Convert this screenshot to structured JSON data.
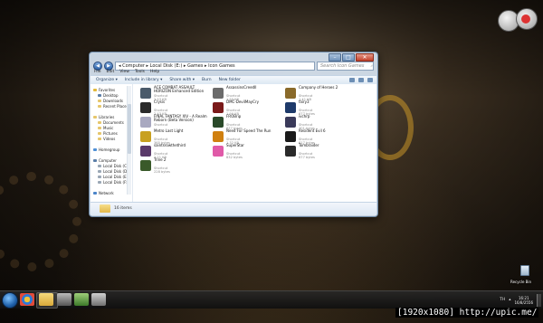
{
  "window": {
    "address_path": "◂ Computer ▸ Local Disk (E:) ▸ Games ▸ Icon Games",
    "search_placeholder": "Search Icon Games",
    "menu": [
      "File",
      "Edit",
      "View",
      "Tools",
      "Help"
    ],
    "toolbar": [
      "Organize ▾",
      "Include in library ▾",
      "Share with ▾",
      "Burn",
      "New folder"
    ],
    "nav_pane": {
      "favorites": "Favorites",
      "favorites_items": [
        "Desktop",
        "Downloads",
        "Recent Places"
      ],
      "libraries": "Libraries",
      "libraries_items": [
        "Documents",
        "Music",
        "Pictures",
        "Videos"
      ],
      "homegroup": "Homegroup",
      "computer": "Computer",
      "computer_items": [
        "Local Disk (C:)",
        "Local Disk (D:)",
        "Local Disk (E:)",
        "Local Disk (F:)"
      ],
      "network": "Network"
    },
    "files": [
      {
        "name": "ACE COMBAT ASSAULT HORIZON Enhanced Edition",
        "type": "Shortcut",
        "size": "2.43 KB",
        "color": "#4a5a6a"
      },
      {
        "name": "AssassinsCreedII",
        "type": "Shortcut",
        "size": "1.55 KB",
        "color": "#6b6b6b"
      },
      {
        "name": "Company of Heroes 2",
        "type": "Shortcut",
        "size": "1.41 KB",
        "color": "#8a6a2a"
      },
      {
        "name": "Crysis",
        "type": "Shortcut",
        "size": "2.43 KB",
        "color": "#2a2a2a"
      },
      {
        "name": "DMC-DevilMayCry",
        "type": "Shortcut",
        "size": "1.99 KB",
        "color": "#7a1a1a"
      },
      {
        "name": "fairy3",
        "type": "Shortcut",
        "size": "677 bytes",
        "color": "#1e3a6a"
      },
      {
        "name": "FINAL FANTASY XIV - A Realm Reborn (Beta Version)",
        "type": "Shortcut",
        "size": "",
        "color": "#a8a8c0"
      },
      {
        "name": "FROBrip",
        "type": "Shortcut",
        "size": "677 bytes",
        "color": "#2a4a2a"
      },
      {
        "name": "ivchrp",
        "type": "Shortcut",
        "size": "701 bytes",
        "color": "#3a3a5a"
      },
      {
        "name": "Metro Last Light",
        "type": "Shortcut",
        "size": "365 bytes",
        "color": "#c8a020"
      },
      {
        "name": "Need For Speed The Run",
        "type": "Shortcut",
        "size": "1.32 KB",
        "color": "#d08010"
      },
      {
        "name": "Resident Evil 6",
        "type": "Shortcut",
        "size": "617 bytes",
        "color": "#1a1a1a"
      },
      {
        "name": "saintsrowthethird",
        "type": "Shortcut",
        "size": "2.21 KB",
        "color": "#5a3a6a"
      },
      {
        "name": "SuperStar",
        "type": "Shortcut",
        "size": "832 bytes",
        "color": "#e05aa8"
      },
      {
        "name": "Tombraider",
        "type": "Shortcut",
        "size": "677 bytes",
        "color": "#2a2a2a"
      },
      {
        "name": "Trine 2",
        "type": "Shortcut",
        "size": "228 bytes",
        "color": "#3a5a2a"
      }
    ],
    "status_count": "16 items"
  },
  "tray": {
    "time": "16:21",
    "date": "16/8/2556",
    "lang": "TH"
  },
  "recycle_bin_label": "Recycle Bin",
  "watermark": "[1920x1080] http://upic.me/"
}
